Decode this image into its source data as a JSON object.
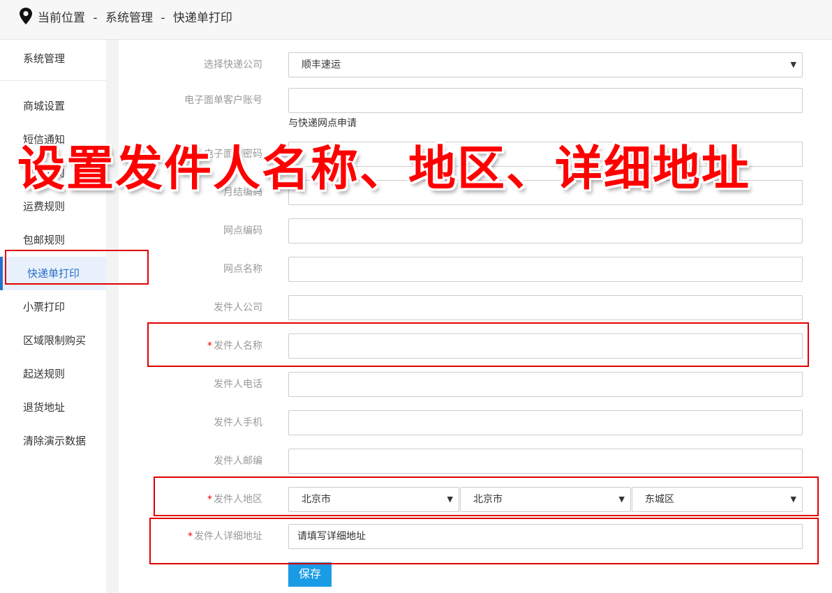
{
  "breadcrumb": {
    "prefix": "当前位置",
    "sep1": "-",
    "level1": "系统管理",
    "sep2": "-",
    "level2": "快递单打印"
  },
  "sidebar": {
    "header": "系统管理",
    "items": [
      {
        "label": "商城设置"
      },
      {
        "label": "短信通知"
      },
      {
        "label": "物流公司"
      },
      {
        "label": "运费规则"
      },
      {
        "label": "包邮规则"
      },
      {
        "label": "快递单打印",
        "active": true
      },
      {
        "label": "小票打印"
      },
      {
        "label": "区域限制购买"
      },
      {
        "label": "起送规则"
      },
      {
        "label": "退货地址"
      },
      {
        "label": "清除演示数据"
      }
    ]
  },
  "form": {
    "express_company": {
      "label": "选择快递公司",
      "value": "顺丰速运"
    },
    "customer_account": {
      "label": "电子面单客户账号",
      "value": "",
      "hint": "与快递网点申请"
    },
    "customer_password": {
      "label": "电子面单密码",
      "value": ""
    },
    "monthly_code": {
      "label": "月结编码",
      "value": ""
    },
    "branch_code": {
      "label": "网点编码",
      "value": ""
    },
    "branch_name": {
      "label": "网点名称",
      "value": ""
    },
    "sender_company": {
      "label": "发件人公司",
      "value": ""
    },
    "sender_name": {
      "label": "发件人名称",
      "value": "",
      "required": "*"
    },
    "sender_phone": {
      "label": "发件人电话",
      "value": ""
    },
    "sender_mobile": {
      "label": "发件人手机",
      "value": ""
    },
    "sender_zip": {
      "label": "发件人邮编",
      "value": ""
    },
    "sender_region": {
      "label": "发件人地区",
      "required": "*",
      "province": "北京市",
      "city": "北京市",
      "district": "东城区"
    },
    "sender_address": {
      "label": "发件人详细地址",
      "required": "*",
      "placeholder": "请填写详细地址"
    },
    "save_label": "保存"
  },
  "overlay_text": "设置发件人名称、地区、详细地址",
  "colors": {
    "accent": "#1a9be6",
    "highlight": "#e00000",
    "active_nav": "#2a6fc9"
  },
  "icons": {
    "location": "map-pin-icon",
    "dropdown": "caret-down-icon"
  }
}
